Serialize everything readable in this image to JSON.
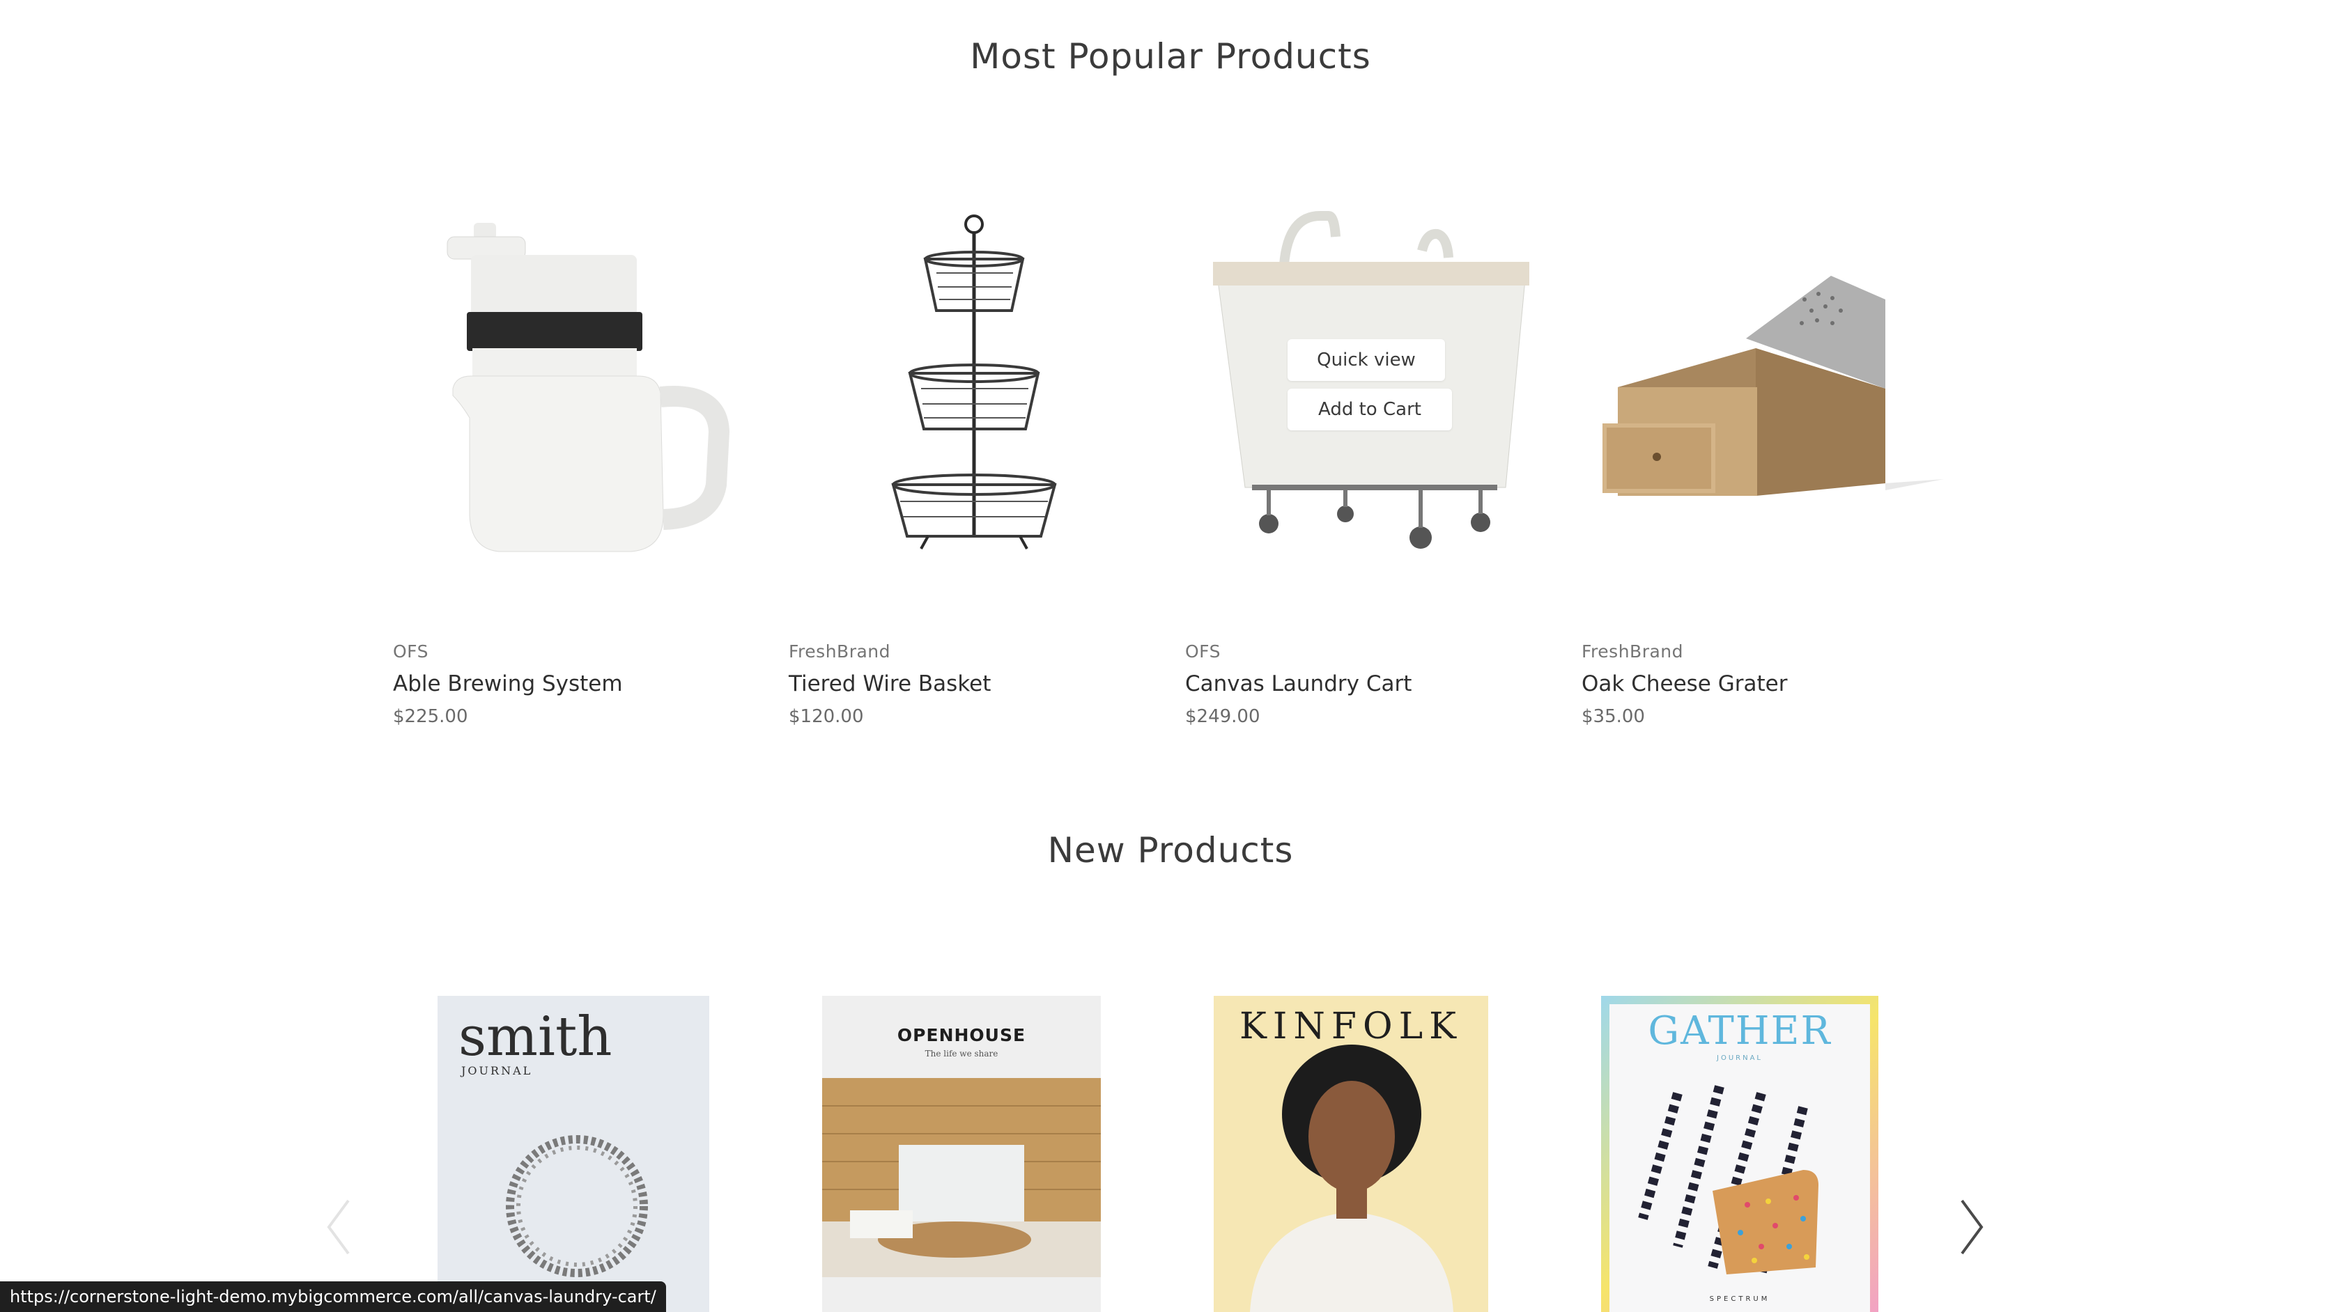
{
  "popular": {
    "title": "Most Popular Products",
    "products": [
      {
        "brand": "OFS",
        "name": "Able Brewing System",
        "price": "$225.00"
      },
      {
        "brand": "FreshBrand",
        "name": "Tiered Wire Basket",
        "price": "$120.00"
      },
      {
        "brand": "OFS",
        "name": "Canvas Laundry Cart",
        "price": "$249.00"
      },
      {
        "brand": "FreshBrand",
        "name": "Oak Cheese Grater",
        "price": "$35.00"
      }
    ],
    "hover_actions": {
      "quick_view": "Quick view",
      "add_to_cart": "Add to Cart"
    }
  },
  "new_products": {
    "title": "New Products",
    "covers": [
      {
        "title": "smith",
        "subtitle": "JOURNAL"
      },
      {
        "title": "OPENHOUSE",
        "subtitle": "The life we share"
      },
      {
        "title": "KINFOLK"
      },
      {
        "title": "GATHER",
        "subtitle": "JOURNAL",
        "footer": "SPECTRUM"
      }
    ]
  },
  "status_url": "https://cornerstone-light-demo.mybigcommerce.com/all/canvas-laundry-cart/",
  "icons": [
    "chevron-left-icon",
    "chevron-right-icon"
  ]
}
